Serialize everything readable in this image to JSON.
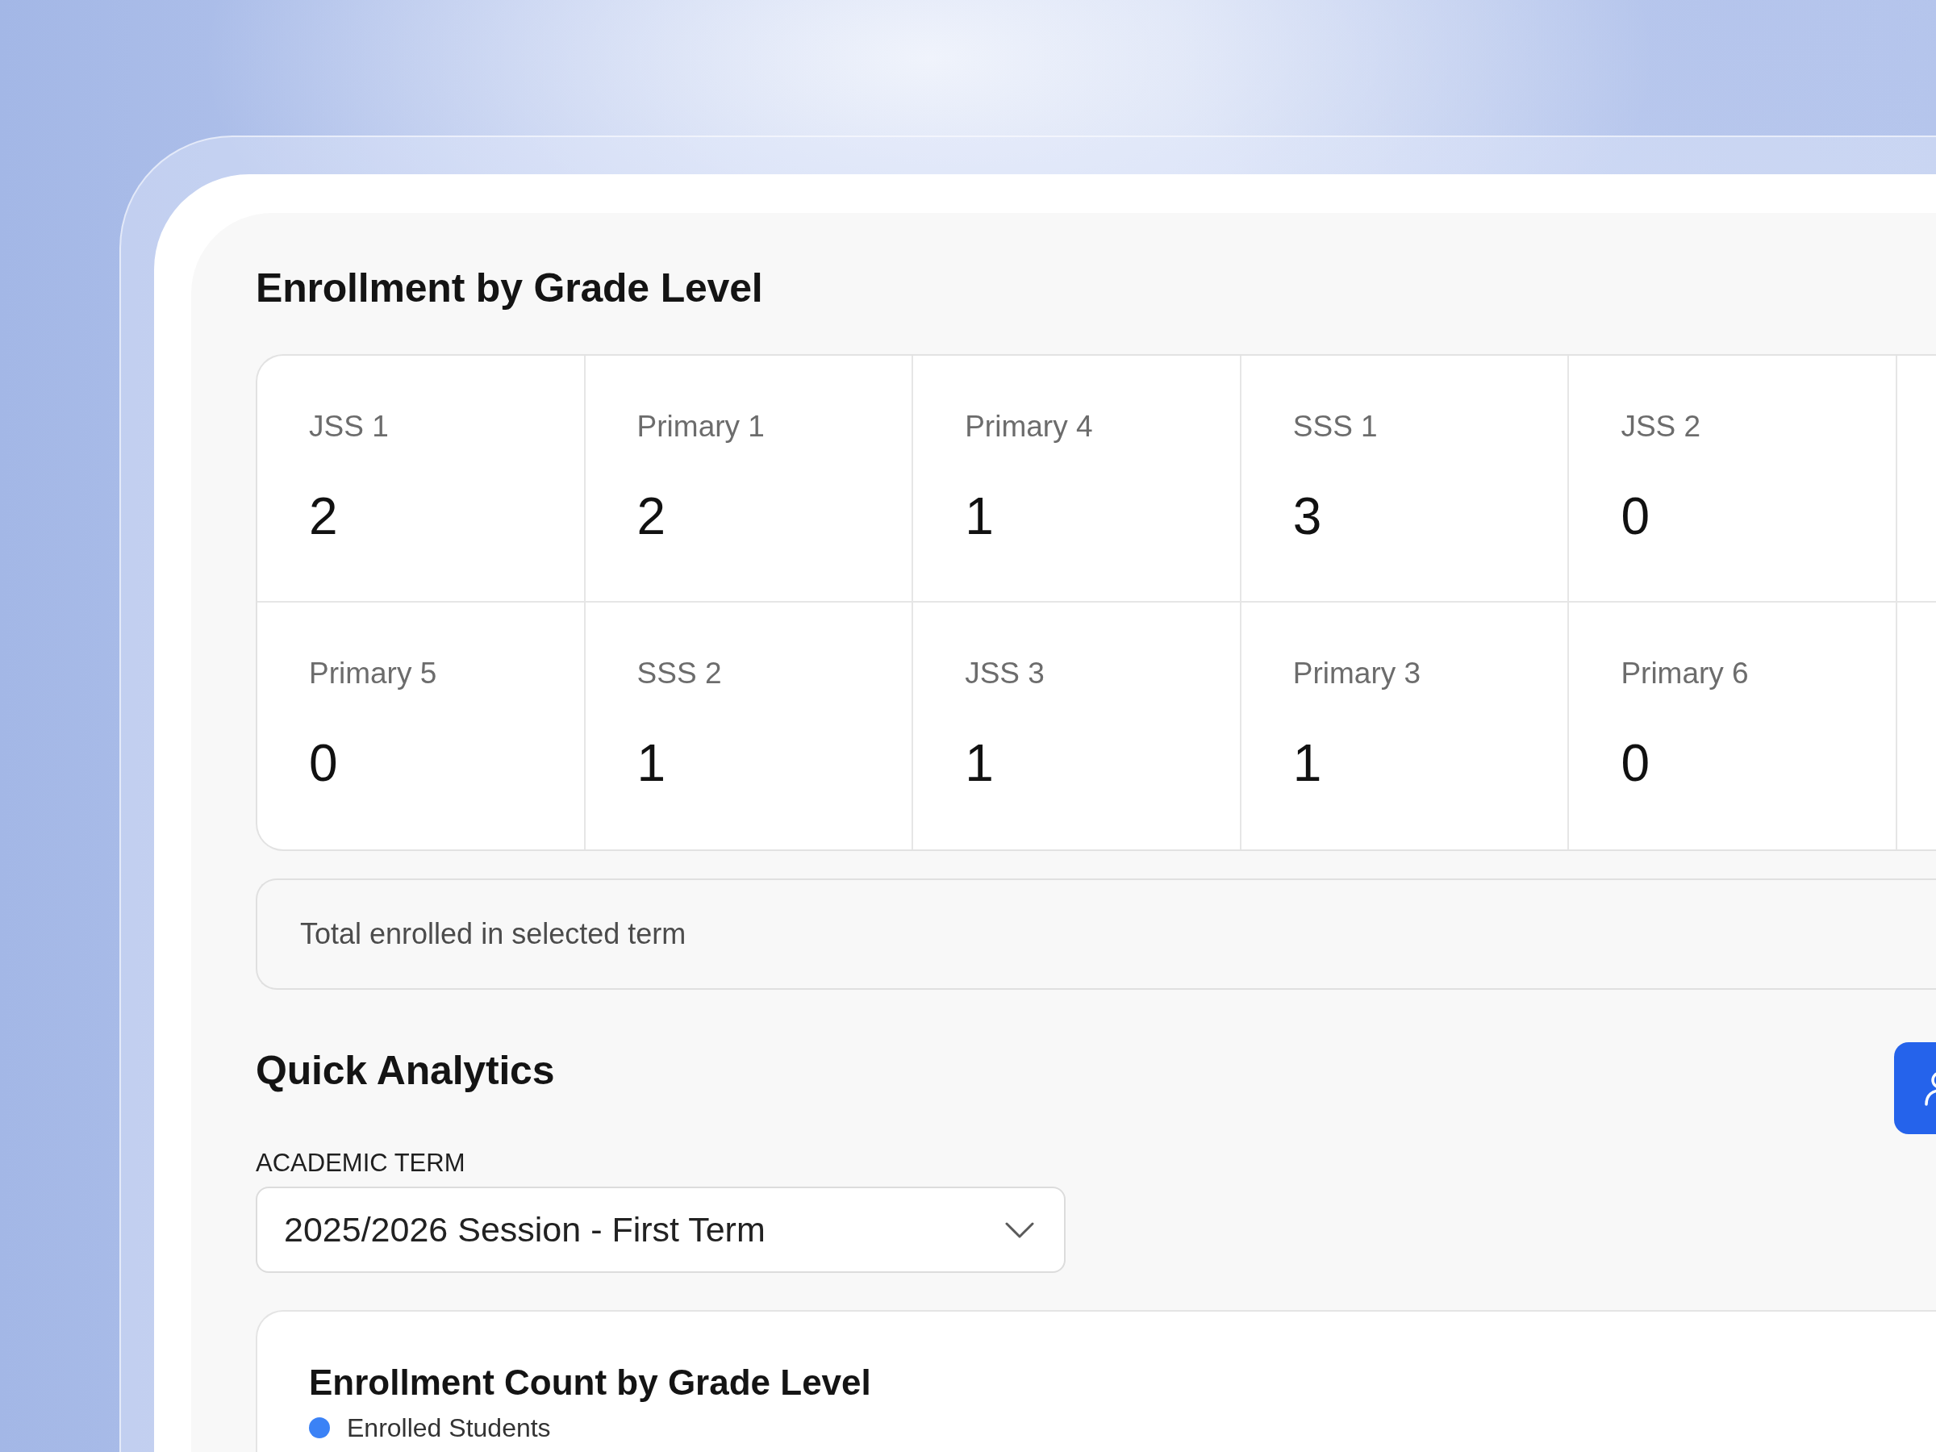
{
  "enrollment_by_grade": {
    "title": "Enrollment by Grade Level",
    "grades": [
      {
        "grade": "JSS 1",
        "count": "2"
      },
      {
        "grade": "Primary 1",
        "count": "2"
      },
      {
        "grade": "Primary 4",
        "count": "1"
      },
      {
        "grade": "SSS 1",
        "count": "3"
      },
      {
        "grade": "JSS 2",
        "count": "0"
      },
      {
        "grade": "Primary 5",
        "count": "0"
      },
      {
        "grade": "SSS 2",
        "count": "1"
      },
      {
        "grade": "JSS 3",
        "count": "1"
      },
      {
        "grade": "Primary 3",
        "count": "1"
      },
      {
        "grade": "Primary 6",
        "count": "0"
      }
    ],
    "total": {
      "label": "Total enrolled in selected term"
    }
  },
  "quick_analytics": {
    "title": "Quick Analytics",
    "term_field": {
      "label": "ACADEMIC TERM",
      "value": "2025/2026 Session - First Term"
    },
    "chart": {
      "title": "Enrollment Count by Grade Level",
      "legend": [
        {
          "label": "Enrolled Students",
          "color": "#3b82f6"
        }
      ]
    }
  }
}
